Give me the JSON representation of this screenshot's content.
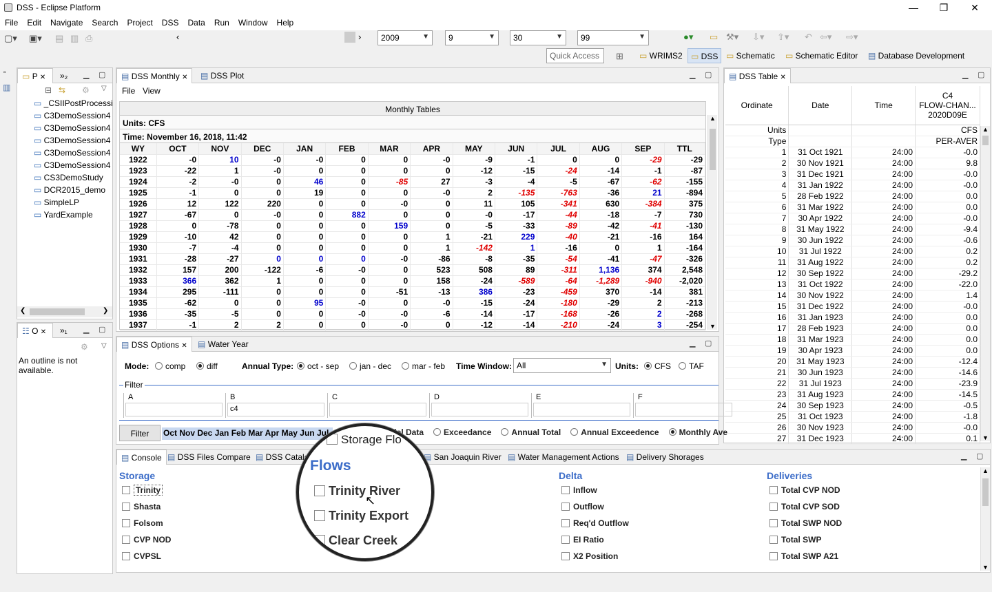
{
  "window": {
    "title": "DSS - Eclipse Platform",
    "min": "—",
    "max": "❐",
    "close": "✕"
  },
  "menu": [
    "File",
    "Edit",
    "Navigate",
    "Search",
    "Project",
    "DSS",
    "Data",
    "Run",
    "Window",
    "Help"
  ],
  "toolbar": {
    "year": "2009",
    "month": "9",
    "day": "30",
    "count": "99",
    "quick_access": "Quick Access"
  },
  "perspectives": [
    "WRIMS2",
    "DSS",
    "Schematic",
    "Schematic Editor",
    "Database Development"
  ],
  "project_explorer": {
    "tab1": "P",
    "tab2": "»₂",
    "items": [
      "_CSIIPostProcessi",
      "C3DemoSession4",
      "C3DemoSession4",
      "C3DemoSession4",
      "C3DemoSession4",
      "C3DemoSession4",
      "CS3DemoStudy",
      "DCR2015_demo",
      "SimpleLP",
      "YardExample"
    ]
  },
  "outline": {
    "tab1": "O",
    "tab2": "»₁",
    "message": "An outline is not available."
  },
  "dss_monthly": {
    "tabs": [
      "DSS Monthly",
      "DSS Plot"
    ],
    "menu": [
      "File",
      "View"
    ],
    "header": "Monthly Tables",
    "units": "Units: CFS",
    "time": "Time: November 16, 2018, 11:42",
    "columns": [
      "WY",
      "OCT",
      "NOV",
      "DEC",
      "JAN",
      "FEB",
      "MAR",
      "APR",
      "MAY",
      "JUN",
      "JUL",
      "AUG",
      "SEP",
      "TTL"
    ],
    "rows": [
      [
        "1922",
        "-0",
        "10",
        "-0",
        "-0",
        "0",
        "0",
        "-0",
        "-9",
        "-1",
        "0",
        "0",
        "-29",
        "-29"
      ],
      [
        "1923",
        "-22",
        "1",
        "-0",
        "0",
        "0",
        "0",
        "0",
        "-12",
        "-15",
        "-24",
        "-14",
        "-1",
        "-87"
      ],
      [
        "1924",
        "-2",
        "-0",
        "0",
        "46",
        "0",
        "-85",
        "27",
        "-3",
        "-4",
        "-5",
        "-67",
        "-62",
        "-155"
      ],
      [
        "1925",
        "-1",
        "0",
        "0",
        "19",
        "0",
        "0",
        "-0",
        "2",
        "-135",
        "-763",
        "-36",
        "21",
        "-894"
      ],
      [
        "1926",
        "12",
        "122",
        "220",
        "0",
        "0",
        "-0",
        "0",
        "11",
        "105",
        "-341",
        "630",
        "-384",
        "375"
      ],
      [
        "1927",
        "-67",
        "0",
        "-0",
        "0",
        "882",
        "0",
        "0",
        "-0",
        "-17",
        "-44",
        "-18",
        "-7",
        "730"
      ],
      [
        "1928",
        "0",
        "-78",
        "0",
        "0",
        "0",
        "159",
        "0",
        "-5",
        "-33",
        "-89",
        "-42",
        "-41",
        "-130"
      ],
      [
        "1929",
        "-10",
        "42",
        "0",
        "0",
        "0",
        "0",
        "1",
        "-21",
        "229",
        "-40",
        "-21",
        "-16",
        "164"
      ],
      [
        "1930",
        "-7",
        "-4",
        "0",
        "0",
        "0",
        "0",
        "1",
        "-142",
        "1",
        "-16",
        "0",
        "1",
        "-164"
      ],
      [
        "1931",
        "-28",
        "-27",
        "0",
        "0",
        "0",
        "-0",
        "-86",
        "-8",
        "-35",
        "-54",
        "-41",
        "-47",
        "-326"
      ],
      [
        "1932",
        "157",
        "200",
        "-122",
        "-6",
        "-0",
        "0",
        "523",
        "508",
        "89",
        "-311",
        "1,136",
        "374",
        "2,548"
      ],
      [
        "1933",
        "366",
        "362",
        "1",
        "0",
        "0",
        "0",
        "158",
        "-24",
        "-589",
        "-64",
        "-1,289",
        "-940",
        "-2,020"
      ],
      [
        "1934",
        "295",
        "-111",
        "0",
        "0",
        "0",
        "-51",
        "-13",
        "386",
        "-23",
        "-459",
        "370",
        "-14",
        "381"
      ],
      [
        "1935",
        "-62",
        "0",
        "0",
        "95",
        "-0",
        "0",
        "-0",
        "-15",
        "-24",
        "-180",
        "-29",
        "2",
        "-213"
      ],
      [
        "1936",
        "-35",
        "-5",
        "0",
        "0",
        "-0",
        "-0",
        "-6",
        "-14",
        "-17",
        "-168",
        "-26",
        "2",
        "-268"
      ],
      [
        "1937",
        "-1",
        "2",
        "2",
        "0",
        "0",
        "-0",
        "0",
        "-12",
        "-14",
        "-210",
        "-24",
        "3",
        "-254"
      ]
    ]
  },
  "dss_table": {
    "tab": "DSS Table",
    "headers": [
      "Ordinate",
      "Date",
      "Time",
      "C4"
    ],
    "header_c4_line2": "FLOW-CHAN...",
    "header_c4_line3": "2020D09E",
    "units_label": "Units",
    "units_value": "CFS",
    "type_label": "Type",
    "type_value": "PER-AVER",
    "rows": [
      [
        "1",
        "31 Oct 1921",
        "24:00",
        "-0.0"
      ],
      [
        "2",
        "30 Nov 1921",
        "24:00",
        "9.8"
      ],
      [
        "3",
        "31 Dec 1921",
        "24:00",
        "-0.0"
      ],
      [
        "4",
        "31 Jan 1922",
        "24:00",
        "-0.0"
      ],
      [
        "5",
        "28 Feb 1922",
        "24:00",
        "0.0"
      ],
      [
        "6",
        "31 Mar 1922",
        "24:00",
        "0.0"
      ],
      [
        "7",
        "30 Apr 1922",
        "24:00",
        "-0.0"
      ],
      [
        "8",
        "31 May 1922",
        "24:00",
        "-9.4"
      ],
      [
        "9",
        "30 Jun 1922",
        "24:00",
        "-0.6"
      ],
      [
        "10",
        "31 Jul 1922",
        "24:00",
        "0.2"
      ],
      [
        "11",
        "31 Aug 1922",
        "24:00",
        "0.2"
      ],
      [
        "12",
        "30 Sep 1922",
        "24:00",
        "-29.2"
      ],
      [
        "13",
        "31 Oct 1922",
        "24:00",
        "-22.0"
      ],
      [
        "14",
        "30 Nov 1922",
        "24:00",
        "1.4"
      ],
      [
        "15",
        "31 Dec 1922",
        "24:00",
        "-0.0"
      ],
      [
        "16",
        "31 Jan 1923",
        "24:00",
        "0.0"
      ],
      [
        "17",
        "28 Feb 1923",
        "24:00",
        "0.0"
      ],
      [
        "18",
        "31 Mar 1923",
        "24:00",
        "0.0"
      ],
      [
        "19",
        "30 Apr 1923",
        "24:00",
        "0.0"
      ],
      [
        "20",
        "31 May 1923",
        "24:00",
        "-12.4"
      ],
      [
        "21",
        "30 Jun 1923",
        "24:00",
        "-14.6"
      ],
      [
        "22",
        "31 Jul 1923",
        "24:00",
        "-23.9"
      ],
      [
        "23",
        "31 Aug 1923",
        "24:00",
        "-14.5"
      ],
      [
        "24",
        "30 Sep 1923",
        "24:00",
        "-0.5"
      ],
      [
        "25",
        "31 Oct 1923",
        "24:00",
        "-1.8"
      ],
      [
        "26",
        "30 Nov 1923",
        "24:00",
        "-0.0"
      ],
      [
        "27",
        "31 Dec 1923",
        "24:00",
        "0.1"
      ]
    ]
  },
  "dss_options": {
    "tabs": [
      "DSS Options",
      "Water Year"
    ],
    "mode_label": "Mode:",
    "mode_comp": "comp",
    "mode_diff": "diff",
    "annual_label": "Annual Type:",
    "annual_oct": "oct - sep",
    "annual_jan": "jan - dec",
    "annual_mar": "mar - feb",
    "time_window_label": "Time Window:",
    "time_window_value": "All",
    "units_label": "Units:",
    "units_cfs": "CFS",
    "units_taf": "TAF",
    "filter_label": "Filter",
    "parts": [
      {
        "label": "A",
        "value": ""
      },
      {
        "label": "B",
        "value": "c4"
      },
      {
        "label": "C",
        "value": ""
      },
      {
        "label": "D",
        "value": ""
      },
      {
        "label": "E",
        "value": ""
      },
      {
        "label": "F",
        "value": ""
      }
    ],
    "filter_button": "Filter",
    "months": "Oct Nov Dec Jan Feb Mar Apr May Jun Jul",
    "options": [
      "odel Data",
      "Exceedance",
      "Annual Total",
      "Annual Exceedence",
      "Monthly Ave"
    ]
  },
  "bottom": {
    "tabs": [
      "Console",
      "DSS Files Compare",
      "DSS Catalo",
      "San Joaquin River",
      "Water Management Actions",
      "Delivery Shorages"
    ],
    "storage_title": "Storage",
    "storage": [
      "Trinity",
      "Shasta",
      "Folsom",
      "CVP NOD",
      "CVPSL"
    ],
    "delta_title": "Delta",
    "delta": [
      "Inflow",
      "Outflow",
      "Req'd Outflow",
      "EI Ratio",
      "X2 Position"
    ],
    "deliveries_title": "Deliveries",
    "deliveries": [
      "Total CVP NOD",
      "Total CVP SOD",
      "Total SWP NOD",
      "Total SWP",
      "Total SWP A21"
    ]
  },
  "magnifier": {
    "tab": "Storage Flo",
    "title": "Flows",
    "items": [
      "Trinity River",
      "Trinity Export",
      "Clear Creek"
    ]
  },
  "colors": {
    "accent": "#3b6cc8",
    "negative": "#e00000",
    "positive": "#0000cc"
  }
}
